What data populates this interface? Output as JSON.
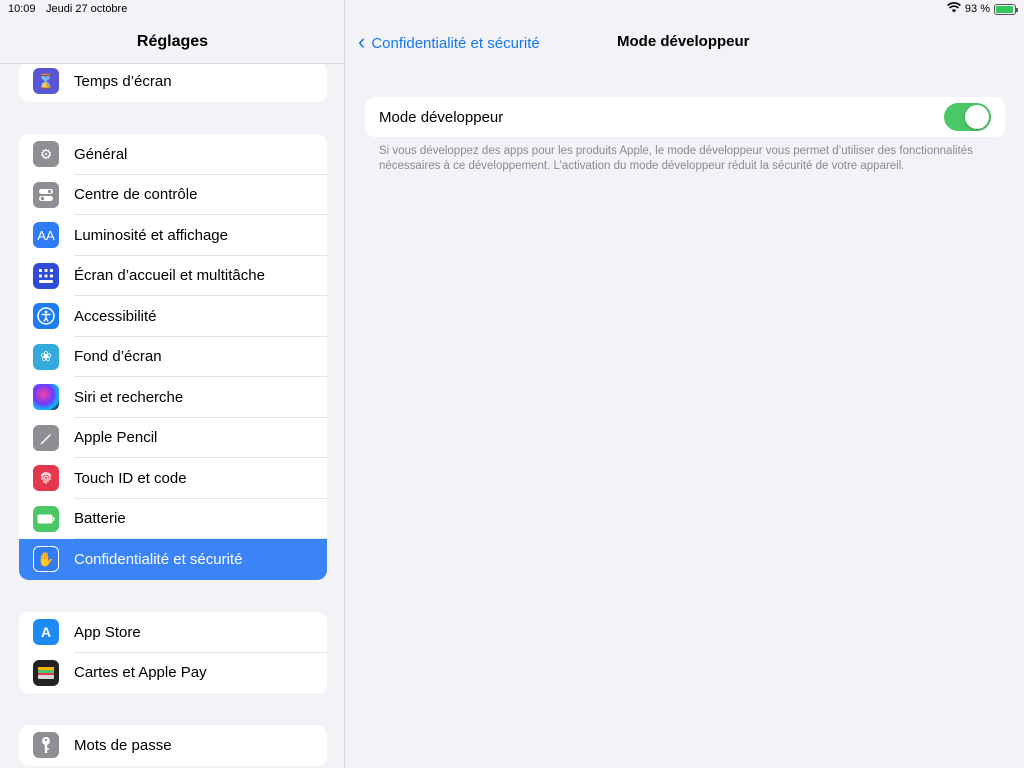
{
  "status": {
    "time": "10:09",
    "date": "Jeudi 27 octobre",
    "battery_percent": "93 %",
    "battery_level": 0.93
  },
  "sidebar": {
    "title": "Réglages",
    "groups": [
      {
        "items": [
          {
            "label": "Temps d’écran",
            "icon": "hourglass-icon",
            "color": "#5856d6"
          }
        ]
      },
      {
        "items": [
          {
            "label": "Général",
            "icon": "gear-icon",
            "color": "#8e8e93"
          },
          {
            "label": "Centre de contrôle",
            "icon": "toggles-icon",
            "color": "#8e8e93"
          },
          {
            "label": "Luminosité et affichage",
            "icon": "text-size-icon",
            "color": "#2f7cf6"
          },
          {
            "label": "Écran d’accueil et multitâche",
            "icon": "grid-icon",
            "color": "#2f4bd8"
          },
          {
            "label": "Accessibilité",
            "icon": "accessibility-icon",
            "color": "#1d7cf2"
          },
          {
            "label": "Fond d’écran",
            "icon": "flower-icon",
            "color": "#35aadc"
          },
          {
            "label": "Siri et recherche",
            "icon": "siri-icon",
            "color": "#222"
          },
          {
            "label": "Apple Pencil",
            "icon": "pencil-icon",
            "color": "#8e8e93"
          },
          {
            "label": "Touch ID et code",
            "icon": "fingerprint-icon",
            "color": "#e5384d"
          },
          {
            "label": "Batterie",
            "icon": "battery-icon",
            "color": "#4cc765"
          },
          {
            "label": "Confidentialité et sécurité",
            "icon": "hand-icon",
            "color": "#2f7cf6",
            "selected": true
          }
        ]
      },
      {
        "items": [
          {
            "label": "App Store",
            "icon": "app-store-icon",
            "color": "#1e8bf5"
          },
          {
            "label": "Cartes et Apple Pay",
            "icon": "wallet-icon",
            "color": "#222"
          }
        ]
      },
      {
        "items": [
          {
            "label": "Mots de passe",
            "icon": "key-icon",
            "color": "#8e8e93"
          }
        ]
      }
    ]
  },
  "main": {
    "back_label": "Confidentialité et sécurité",
    "title": "Mode développeur",
    "setting_label": "Mode développeur",
    "toggle_on": true,
    "footnote": "Si vous développez des apps pour les produits Apple, le mode développeur vous permet d’utiliser des fonctionnalités nécessaires à ce développement. L’activation du mode développeur réduit la sécurité de votre appareil."
  }
}
